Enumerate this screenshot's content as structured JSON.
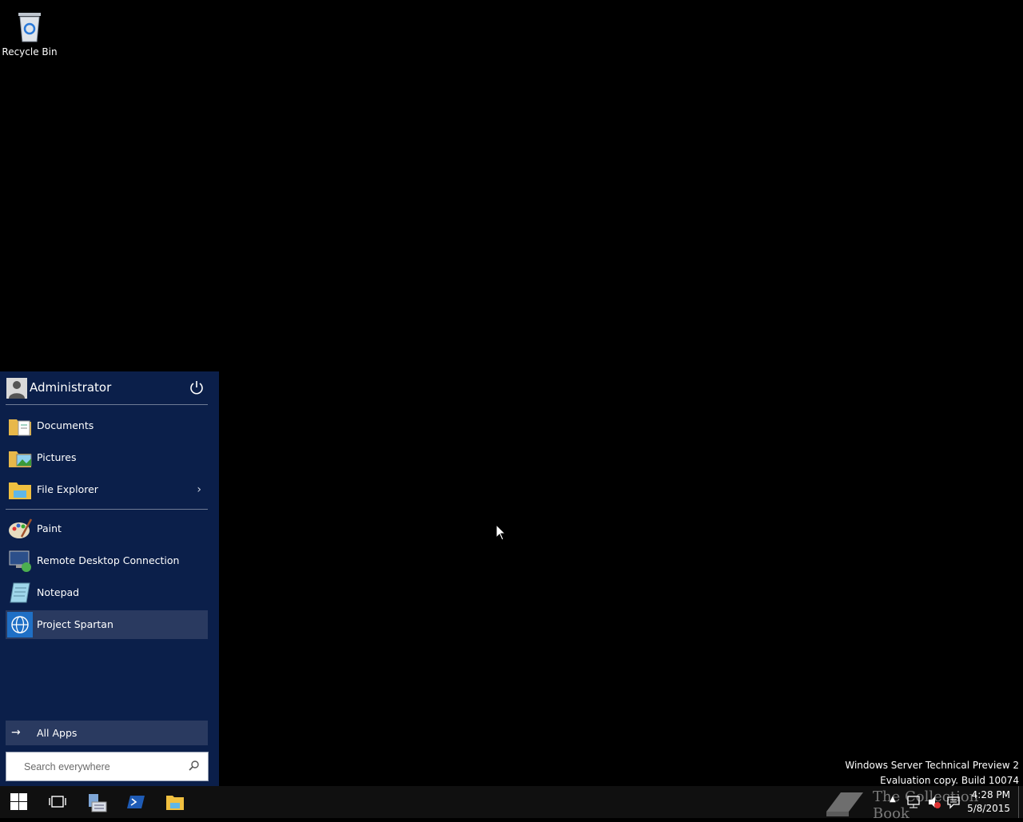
{
  "desktop": {
    "icons": [
      {
        "label": "Recycle Bin",
        "icon": "recycle-bin-icon"
      }
    ]
  },
  "start_menu": {
    "user": {
      "name": "Administrator",
      "avatar_icon": "user-avatar-icon",
      "power_icon": "power-icon"
    },
    "places": [
      {
        "label": "Documents",
        "icon": "documents-folder-icon"
      },
      {
        "label": "Pictures",
        "icon": "pictures-folder-icon"
      },
      {
        "label": "File Explorer",
        "icon": "file-explorer-icon",
        "submenu": true
      }
    ],
    "apps": [
      {
        "label": "Paint",
        "icon": "paint-icon"
      },
      {
        "label": "Remote Desktop Connection",
        "icon": "remote-desktop-icon"
      },
      {
        "label": "Notepad",
        "icon": "notepad-icon"
      },
      {
        "label": "Project Spartan",
        "icon": "globe-icon",
        "selected": true
      }
    ],
    "all_apps_label": "All Apps",
    "search": {
      "placeholder": "Search everywhere",
      "value": ""
    }
  },
  "watermark": {
    "line1": "Windows Server Technical Preview 2",
    "line2": "Evaluation copy. Build 10074"
  },
  "taskbar": {
    "buttons": [
      "start-button",
      "task-view-button",
      "server-manager-button",
      "powershell-button",
      "file-explorer-button"
    ],
    "overlay_text": "The Collection Book",
    "clock": {
      "time": "4:28 PM",
      "date": "5/8/2015"
    }
  },
  "colors": {
    "start_bg": "#0b1f4a",
    "selected_bg": "#2a3a60",
    "taskbar_bg": "#101010"
  }
}
